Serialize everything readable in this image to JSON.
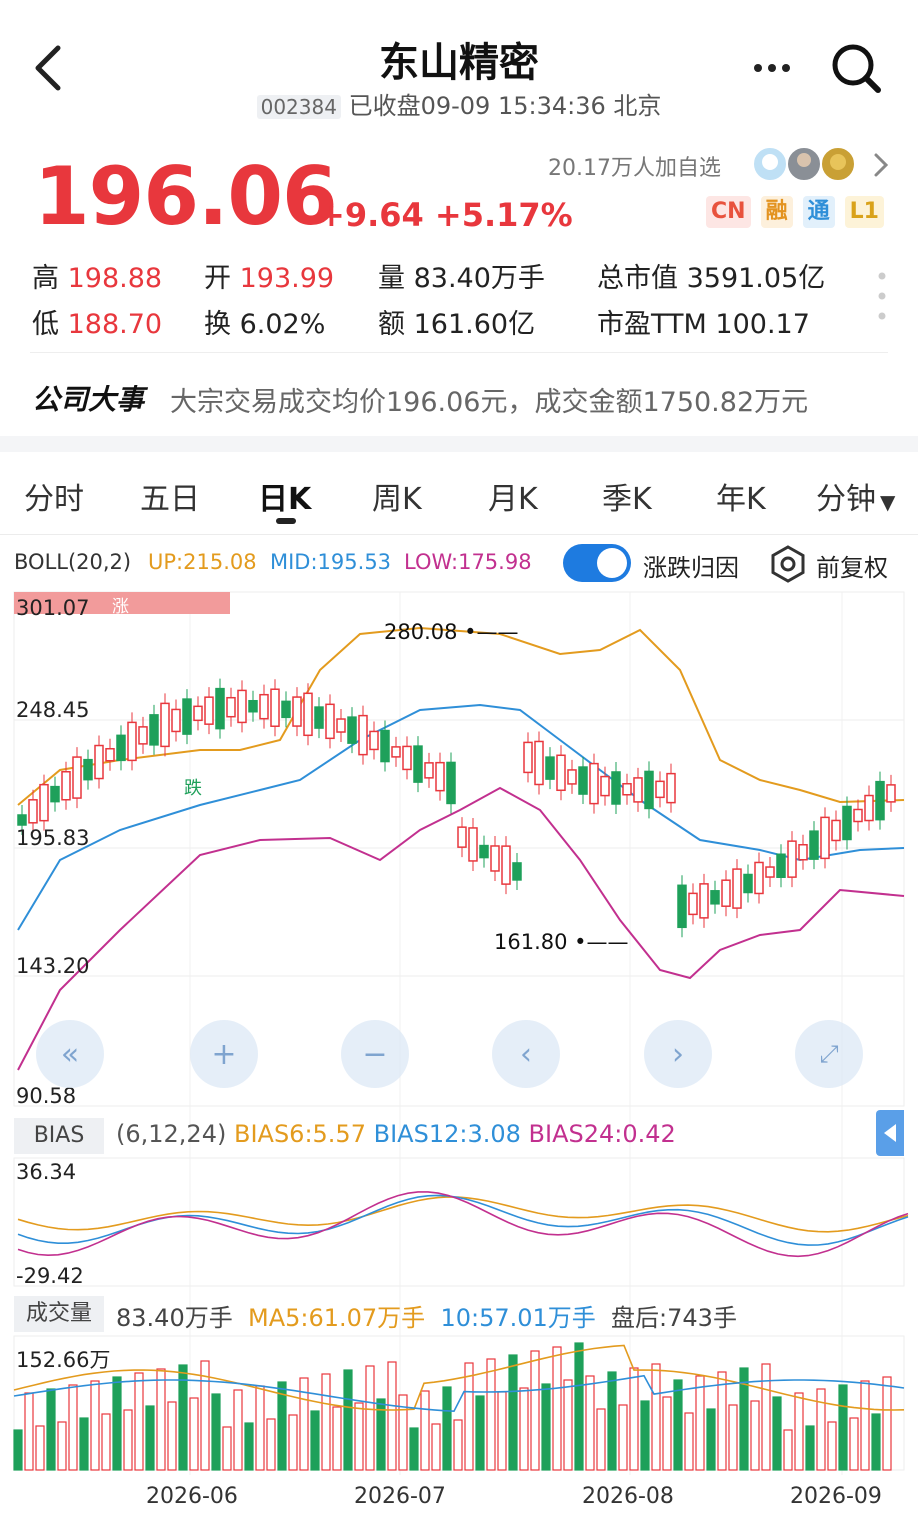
{
  "header": {
    "title": "东山精密",
    "code": "002384",
    "status": "已收盘09-09 15:34:36 北京"
  },
  "quote": {
    "price": "196.06",
    "change": "+9.64 +5.17%",
    "followers": "20.17万人加自选",
    "badges": [
      "CN",
      "融",
      "通",
      "L1"
    ]
  },
  "stats": {
    "high_label": "高",
    "high": "198.88",
    "open_label": "开",
    "open": "193.99",
    "vol_label": "量",
    "vol": "83.40万手",
    "mcap_label": "总市值",
    "mcap": "3591.05亿",
    "low_label": "低",
    "low": "188.70",
    "turnover_label": "换",
    "turnover": "6.02%",
    "amount_label": "额",
    "amount": "161.60亿",
    "pe_label": "市盈TTM",
    "pe": "100.17"
  },
  "event": {
    "label": "公司大事",
    "text": "大宗交易成交均价196.06元，成交金额1750.82万元"
  },
  "tabs": [
    "分时",
    "五日",
    "日K",
    "周K",
    "月K",
    "季K",
    "年K",
    "分钟"
  ],
  "boll": {
    "name": "BOLL(20,2)",
    "up": "UP:215.08",
    "mid": "MID:195.53",
    "low": "LOW:175.98",
    "toggle_label": "涨跌归因",
    "fq_label": "前复权"
  },
  "kline": {
    "y_labels": [
      "301.07",
      "248.45",
      "195.83",
      "143.20",
      "90.58"
    ],
    "tag_up": "涨",
    "tag_down": "跌",
    "high_mark": "280.08",
    "low_mark": "161.80"
  },
  "bias": {
    "tag": "BIAS",
    "params": "(6,12,24)",
    "b6": "BIAS6:5.57",
    "b12": "BIAS12:3.08",
    "b24": "BIAS24:0.42",
    "y_top": "36.34",
    "y_bottom": "-29.42"
  },
  "volume": {
    "tag": "成交量",
    "vol": "83.40万手",
    "ma5": "MA5:61.07万手",
    "ma10": "10:57.01万手",
    "after": "盘后:743手",
    "y_top": "152.66万"
  },
  "x_labels": [
    "2026-06",
    "2026-07",
    "2026-08",
    "2026-09"
  ],
  "colors": {
    "up": "#e8373d",
    "down": "#1ea05a",
    "boll_up": "#e39b1e",
    "boll_mid": "#2f8fd8",
    "boll_low": "#c2308f"
  }
}
